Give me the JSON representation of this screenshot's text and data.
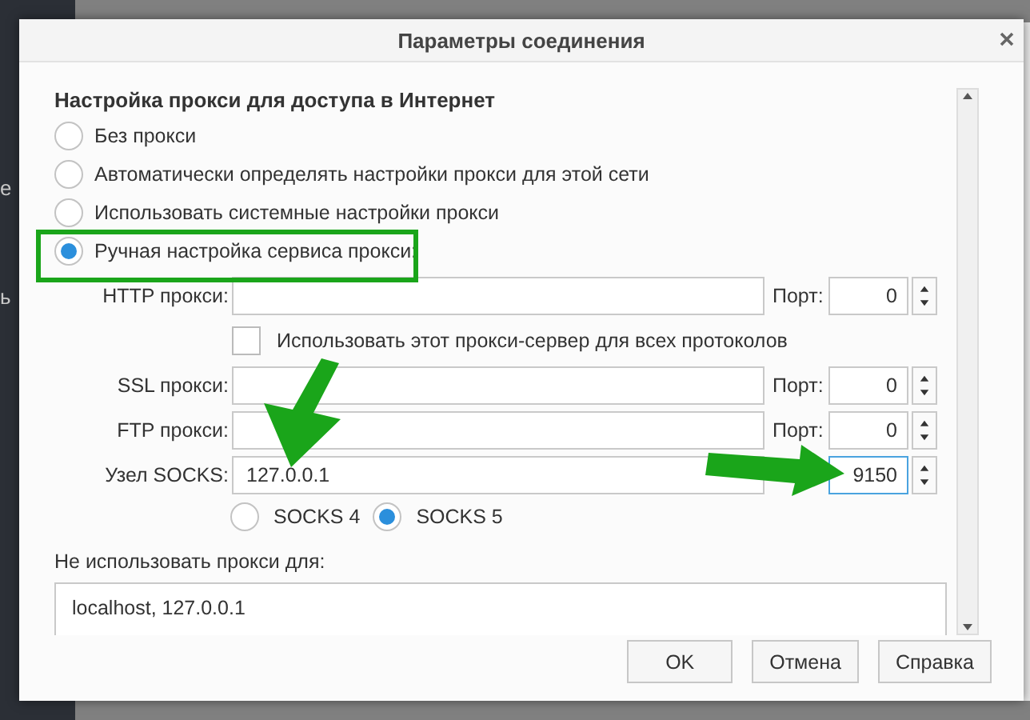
{
  "background": {
    "left_fragments": [
      "е",
      "ь"
    ]
  },
  "dialog": {
    "title": "Параметры соединения",
    "section_title": "Настройка прокси для доступа в Интернет",
    "modes": [
      {
        "label": "Без прокси",
        "selected": false
      },
      {
        "label": "Автоматически определять настройки прокси для этой сети",
        "selected": false
      },
      {
        "label": "Использовать системные настройки прокси",
        "selected": false
      },
      {
        "label": "Ручная настройка сервиса прокси:",
        "selected": true
      }
    ],
    "proxies": [
      {
        "label": "HTTP прокси:",
        "port_label": "Порт:",
        "port": "0",
        "focused": false
      },
      {
        "kind": "checkbox",
        "label": "Использовать этот прокси-сервер для всех протоколов",
        "checked": false
      },
      {
        "label": "SSL прокси:",
        "port_label": "Порт:",
        "port": "0",
        "focused": false
      },
      {
        "label": "FTP прокси:",
        "port_label": "Порт:",
        "port": "0",
        "focused": false
      },
      {
        "label": "Узел SOCKS:",
        "value": "127.0.0.1",
        "port": "9150",
        "focused": true
      }
    ],
    "socks_versions": [
      {
        "label": "SOCKS 4",
        "selected": false
      },
      {
        "label": "SOCKS 5",
        "selected": true
      }
    ],
    "no_proxy": {
      "label": "Не использовать прокси для:",
      "value": "localhost, 127.0.0.1"
    },
    "buttons": [
      "OK",
      "Отмена",
      "Справка"
    ]
  }
}
